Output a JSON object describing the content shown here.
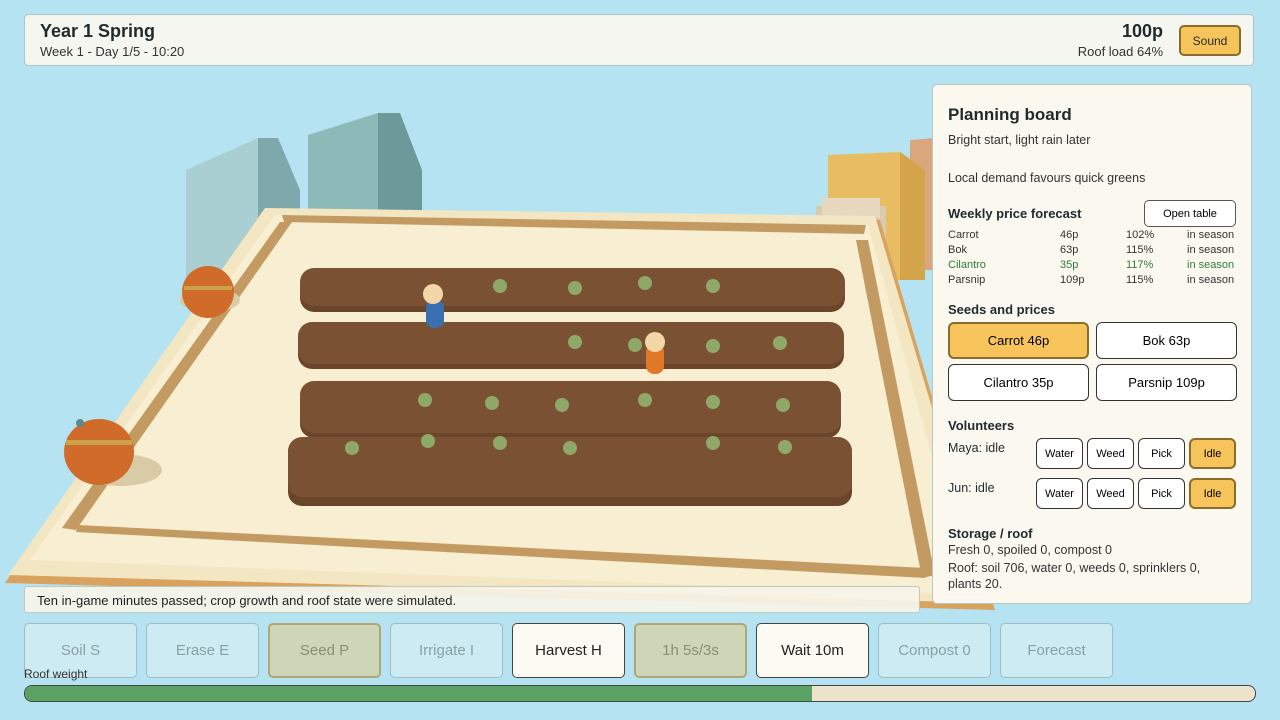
{
  "header": {
    "season": "Year 1 Spring",
    "date": "Week 1 - Day 1/5 - 10:20",
    "money": "100p",
    "roof_load": "Roof load 64%",
    "sound_label": "Sound"
  },
  "planning": {
    "title": "Planning board",
    "weather": "Bright start, light rain later",
    "demand": "Local demand favours quick greens",
    "forecast_heading": "Weekly price forecast",
    "open_table_label": "Open table",
    "forecast": [
      {
        "crop": "Carrot",
        "price": "46p",
        "pct": "102%",
        "status": "in season"
      },
      {
        "crop": "Bok",
        "price": "63p",
        "pct": "115%",
        "status": "in season"
      },
      {
        "crop": "Cilantro",
        "price": "35p",
        "pct": "117%",
        "status": "in season"
      },
      {
        "crop": "Parsnip",
        "price": "109p",
        "pct": "115%",
        "status": "in season"
      }
    ],
    "seeds_heading": "Seeds and prices",
    "seeds": [
      "Carrot 46p",
      "Bok 63p",
      "Cilantro 35p",
      "Parsnip 109p"
    ],
    "selected_seed": "Carrot 46p",
    "volunteers_heading": "Volunteers",
    "volunteers": [
      {
        "label": "Maya: idle",
        "actions": [
          "Water",
          "Weed",
          "Pick",
          "Idle"
        ],
        "selected": "Idle"
      },
      {
        "label": "Jun: idle",
        "actions": [
          "Water",
          "Weed",
          "Pick",
          "Idle"
        ],
        "selected": "Idle"
      }
    ],
    "storage_heading": "Storage / roof",
    "storage_line1": "Fresh 0, spoiled 0, compost 0",
    "storage_line2": "Roof: soil 706, water 0, weeds 0, sprinklers 0,",
    "storage_line3": "plants 20."
  },
  "status_message": "Ten in-game minutes passed; crop growth and roof state were simulated.",
  "tools": [
    {
      "label": "Soil S",
      "state": "disabled"
    },
    {
      "label": "Erase E",
      "state": "disabled"
    },
    {
      "label": "Seed P",
      "state": "pressed"
    },
    {
      "label": "Irrigate I",
      "state": "disabled"
    },
    {
      "label": "Harvest H",
      "state": "enabled"
    },
    {
      "label": "1h 5s/3s",
      "state": "pressed"
    },
    {
      "label": "Wait 10m",
      "state": "enabled"
    },
    {
      "label": "Compost 0",
      "state": "disabled"
    },
    {
      "label": "Forecast",
      "state": "disabled"
    }
  ],
  "roof_weight": {
    "label": "Roof weight",
    "fraction": 0.64
  },
  "colors": {
    "accent": "#f6c45a",
    "sky": "#b6e3f1",
    "soil": "#7a5233",
    "roof_bar": "#5aa263"
  }
}
